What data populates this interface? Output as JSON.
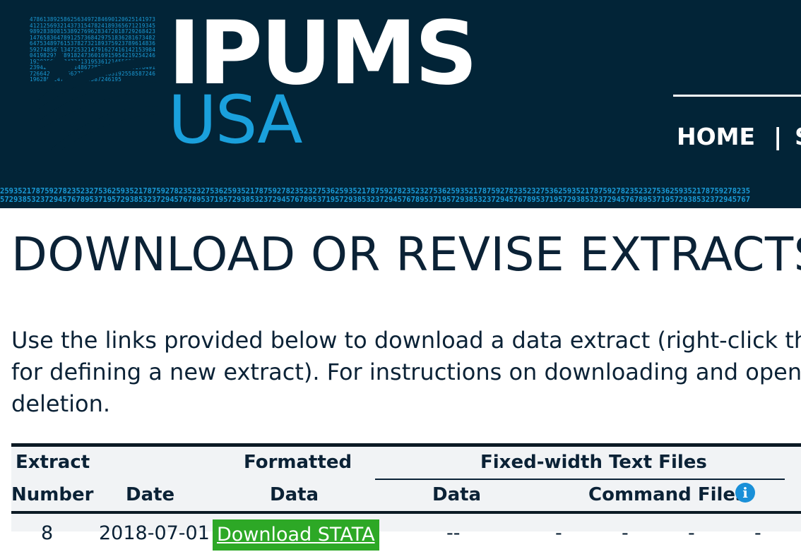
{
  "header": {
    "brand_name": "IPUMS",
    "brand_sub": "USA",
    "logo_digits": "4786138925862563497284690120625141973412125693214373154782418936567121934598928380815389276962834720187292684231476583647891257368429751836281673482647534897615378273218937592378961483659274856213472532147916274161421539840419829186891824736016915954219254246193825627684724131953612145563876428423942865258271486728362456345461764917266424328156278997931663192558587246196289514792543650587246195",
    "nav": {
      "home": "HOME",
      "separator": "|",
      "next_item": "S"
    },
    "digit_strip_line1": "259352178759278235232753625935217875927823523275362593521787592782352327536259352178759278235232753625935217875927823523275362593521787592782352327536259352178759278235",
    "digit_strip_line2": "572938532372945767895371957293853237294576789537195729385323729457678953719572938532372945767895371957293853237294576789537195729385323729457678953719572938532372945767"
  },
  "page": {
    "title": "DOWNLOAD OR REVISE EXTRACTS",
    "intro_line1": "Use the links provided below to download a data extract (right-click th",
    "intro_line2": "for defining a new extract). For instructions on downloading and open",
    "intro_line3": "deletion."
  },
  "table": {
    "headers": {
      "extract": "Extract",
      "number": "Number",
      "date": "Date",
      "formatted": "Formatted",
      "data": "Data",
      "fixed_width": "Fixed-width Text Files",
      "fw_data": "Data",
      "command_files": "Command Files",
      "info_icon_glyph": "i"
    },
    "rows": [
      {
        "number": "8",
        "date": "2018-07-01",
        "formatted_link": "Download STATA",
        "fw_data": "--",
        "cmd1": "-",
        "cmd2": "-",
        "cmd3": "-",
        "cmd4": "-"
      }
    ]
  },
  "colors": {
    "header_bg": "#022437",
    "accent_blue": "#1aa0dc",
    "download_green": "#2da826",
    "text": "#0b2236"
  }
}
